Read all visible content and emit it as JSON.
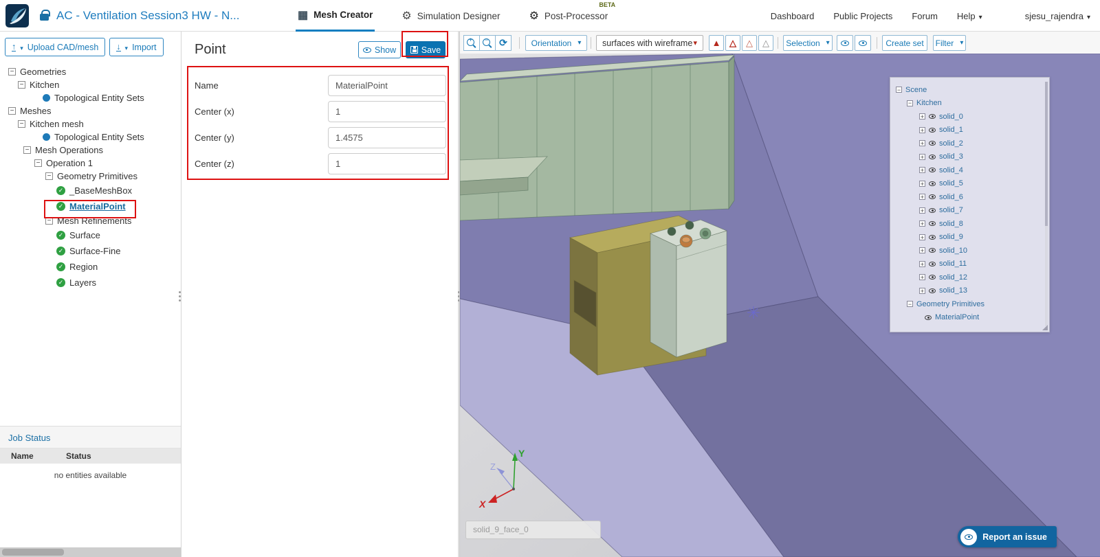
{
  "header": {
    "title": "AC - Ventilation Session3 HW - N...",
    "tabs": [
      {
        "label": "Mesh Creator"
      },
      {
        "label": "Simulation Designer"
      },
      {
        "label": "Post-Processor",
        "beta": "BETA"
      }
    ],
    "nav": [
      "Dashboard",
      "Public Projects",
      "Forum"
    ],
    "help_label": "Help",
    "user": "sjesu_rajendra"
  },
  "sidebar": {
    "upload_button": "Upload CAD/mesh",
    "import_button": "Import",
    "tree": {
      "geometries": "Geometries",
      "kitchen": "Kitchen",
      "topo_sets_geo": "Topological Entity Sets",
      "meshes": "Meshes",
      "kitchen_mesh": "Kitchen mesh",
      "topo_sets_mesh": "Topological Entity Sets",
      "mesh_operations": "Mesh Operations",
      "operation_1": "Operation 1",
      "geometry_primitives": "Geometry Primitives",
      "base_mesh_box": "_BaseMeshBox",
      "material_point": "MaterialPoint",
      "mesh_refinements": "Mesh Refinements",
      "surface": "Surface",
      "surface_fine": "Surface-Fine",
      "region": "Region",
      "layers": "Layers"
    },
    "job_status": {
      "title": "Job Status",
      "columns": [
        "Name",
        "Status"
      ],
      "empty_message": "no entities available"
    }
  },
  "panel": {
    "title": "Point",
    "show_button": "Show",
    "save_button": "Save",
    "fields": [
      {
        "label": "Name",
        "value": "MaterialPoint"
      },
      {
        "label": "Center (x)",
        "value": "1"
      },
      {
        "label": "Center (y)",
        "value": "1.4575"
      },
      {
        "label": "Center (z)",
        "value": "1"
      }
    ]
  },
  "viewport": {
    "toolbar": {
      "orientation": "Orientation",
      "render_mode": "surfaces with wireframe",
      "selection": "Selection",
      "create_set": "Create set",
      "filter": "Filter"
    },
    "scene_tree": {
      "root": "Scene",
      "kitchen": "Kitchen",
      "solids": [
        "solid_0",
        "solid_1",
        "solid_2",
        "solid_3",
        "solid_4",
        "solid_5",
        "solid_6",
        "solid_7",
        "solid_8",
        "solid_9",
        "solid_10",
        "solid_11",
        "solid_12",
        "solid_13"
      ],
      "geometry_primitives": "Geometry Primitives",
      "material_point": "MaterialPoint"
    },
    "axis": {
      "x": "X",
      "y": "Y",
      "z": "Z"
    },
    "tooltip": "solid_9_face_0",
    "report_button": "Report an issue"
  },
  "colors": {
    "accent_blue": "#1a7ab8",
    "active_tab_underline": "#0f7ec0",
    "save_button_bg": "#0a72b2",
    "annotation_red": "#dd1111",
    "check_green": "#2fa042",
    "entity_dot_blue": "#1e7ab8",
    "wall_purple": "#8886b8",
    "floor_lavender": "#b2b0d6",
    "cabinet_green": "#a4b8a1",
    "counter_olive": "#988f4a",
    "report_button_bg": "#1265a0"
  }
}
